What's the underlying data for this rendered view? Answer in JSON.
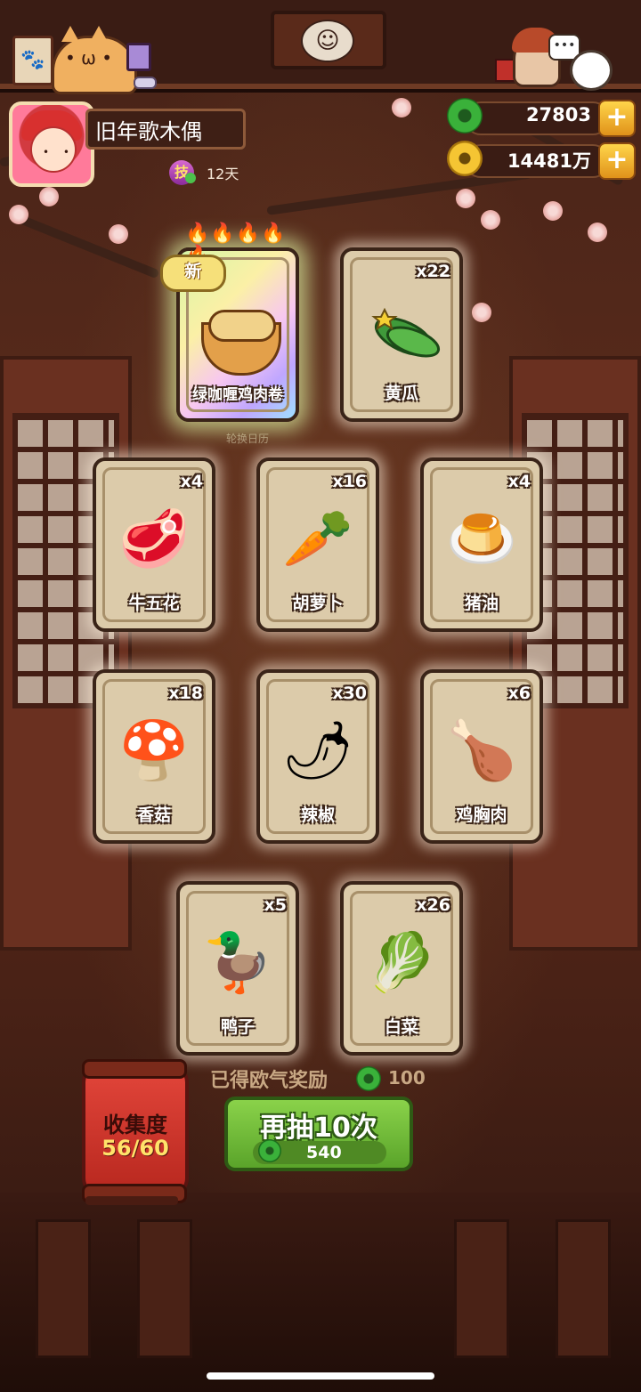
{
  "player": {
    "name": "旧年歌木偶",
    "skill_icon": "技",
    "days": "12天"
  },
  "currency": {
    "jade": "27803",
    "coins": "14481万",
    "add_symbol": "+"
  },
  "cards": [
    {
      "name": "绿咖喱鸡肉卷",
      "count": "",
      "new_label": "新",
      "glyph": "curry-dish"
    },
    {
      "name": "黄瓜",
      "count": "x22",
      "glyph": "cucumber"
    },
    {
      "name": "牛五花",
      "count": "x4",
      "glyph": "🥩"
    },
    {
      "name": "胡萝卜",
      "count": "x16",
      "glyph": "🥕"
    },
    {
      "name": "猪油",
      "count": "x4",
      "glyph": "🍮"
    },
    {
      "name": "香菇",
      "count": "x18",
      "glyph": "🍄"
    },
    {
      "name": "辣椒",
      "count": "x30",
      "glyph": "🌶"
    },
    {
      "name": "鸡胸肉",
      "count": "x6",
      "glyph": "🍗"
    },
    {
      "name": "鸭子",
      "count": "x5",
      "glyph": "🦆"
    },
    {
      "name": "白菜",
      "count": "x26",
      "glyph": "🥬"
    }
  ],
  "background_label": "轮换日历",
  "reward": {
    "text": "已得欧气奖励",
    "amount": "100"
  },
  "collection": {
    "title": "收集度",
    "value": "56/60"
  },
  "draw_button": {
    "label": "再抽10次",
    "cost": "540"
  },
  "colors": {
    "accent_green": "#5aa42a",
    "lantern_red": "#d23a30",
    "card_bg": "#dccbaa"
  }
}
